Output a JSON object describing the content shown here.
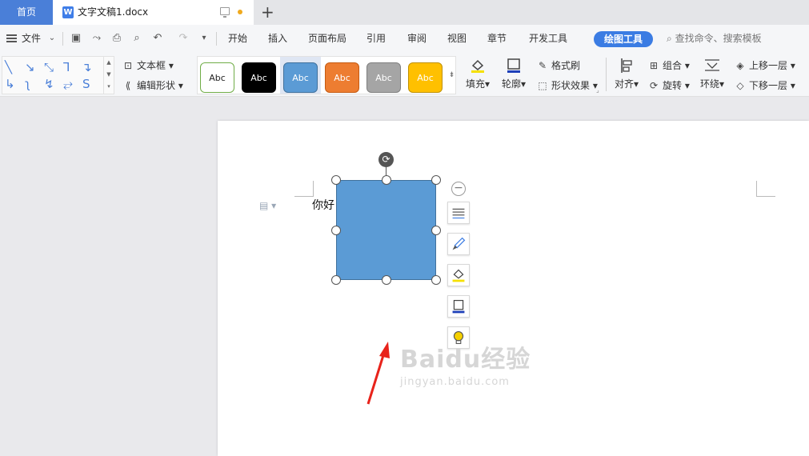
{
  "tabs": {
    "home": "首页",
    "doc_icon": "W",
    "doc_name": "文字文稿1.docx",
    "new_tab_symbol": "+"
  },
  "menubar": {
    "file": "文件",
    "items": [
      "开始",
      "插入",
      "页面布局",
      "引用",
      "审阅",
      "视图",
      "章节",
      "开发工具"
    ],
    "active_tool": "绘图工具",
    "search_placeholder": "查找命令、搜索模板"
  },
  "ribbon": {
    "text_box": "文本框",
    "edit_shape": "编辑形状",
    "style_label": "Abc",
    "styles": [
      {
        "bg": "#ffffff",
        "border": "#70ad47",
        "color": "#222222"
      },
      {
        "bg": "#000000",
        "border": "#000000",
        "color": "#ffffff"
      },
      {
        "bg": "#5b9bd5",
        "border": "#41719c",
        "color": "#ffffff"
      },
      {
        "bg": "#ed7d31",
        "border": "#c55a11",
        "color": "#ffffff"
      },
      {
        "bg": "#a5a5a5",
        "border": "#7f7f7f",
        "color": "#ffffff"
      },
      {
        "bg": "#ffc000",
        "border": "#bf9000",
        "color": "#ffffff"
      }
    ],
    "fill": "填充",
    "outline": "轮廓",
    "format_painter": "格式刷",
    "shape_effects": "形状效果",
    "align": "对齐",
    "group": "组合",
    "rotate": "旋转",
    "wrap": "环绕",
    "bring_forward": "上移一层",
    "send_backward": "下移一层"
  },
  "document": {
    "text": "你好",
    "shape_fill": "#5b9bd5",
    "shape_border": "#41719c"
  },
  "watermark": {
    "logo": "Baidu经验",
    "url": "jingyan.baidu.com"
  },
  "colors": {
    "accent": "#3b7ce3",
    "arrow": "#e8231b"
  }
}
